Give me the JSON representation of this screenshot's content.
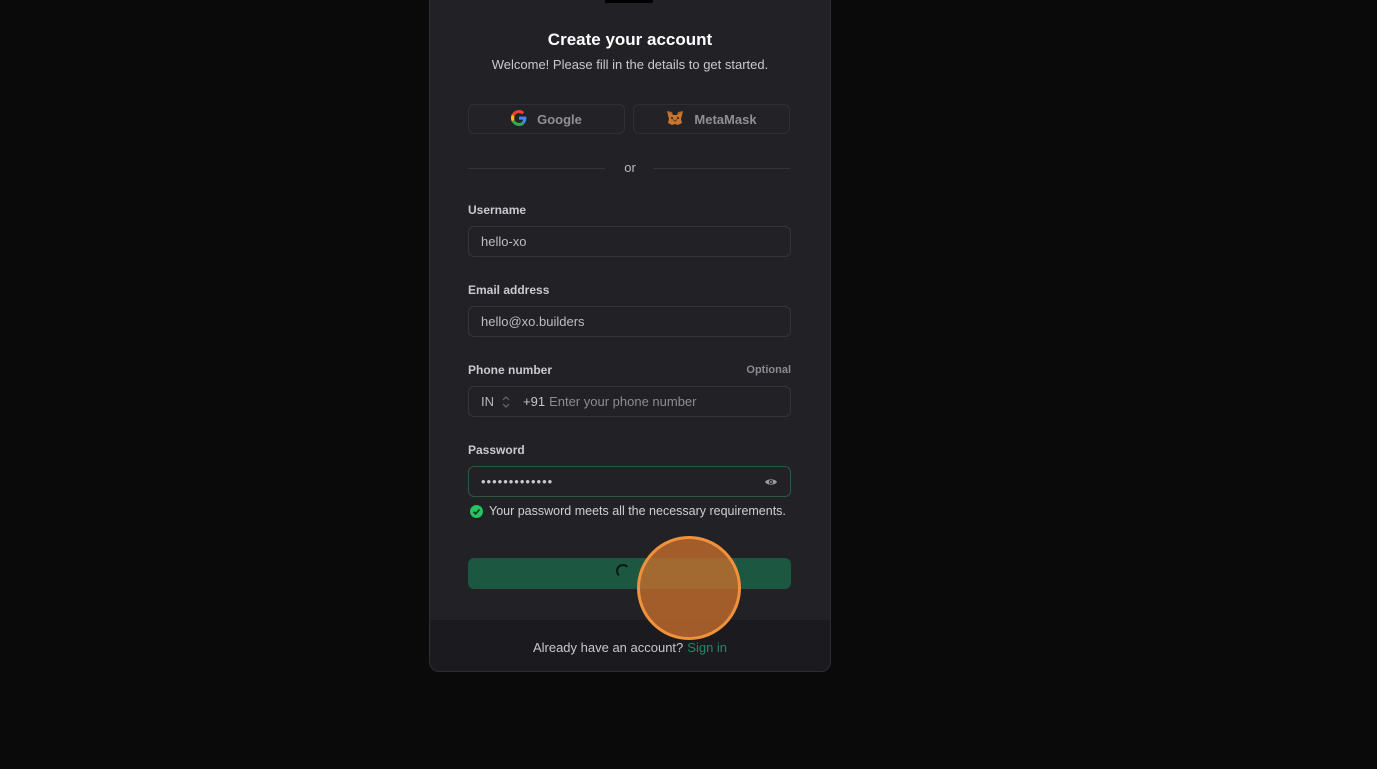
{
  "header": {
    "title": "Create your account",
    "subtitle": "Welcome! Please fill in the details to get started."
  },
  "social": {
    "google_label": "Google",
    "metamask_label": "MetaMask"
  },
  "divider": {
    "text": "or"
  },
  "form": {
    "username": {
      "label": "Username",
      "value": "hello-xo"
    },
    "email": {
      "label": "Email address",
      "value": "hello@xo.builders"
    },
    "phone": {
      "label": "Phone number",
      "optional_label": "Optional",
      "country": "IN",
      "dial_code": "+91",
      "placeholder": "Enter your phone number"
    },
    "password": {
      "label": "Password",
      "masked_value": "•••••••••••••",
      "hint": "Your password meets all the necessary requirements."
    }
  },
  "footer": {
    "prompt": "Already have an account?",
    "link": "Sign in"
  },
  "colors": {
    "accent": "#1b5741",
    "link": "#1f8a63",
    "success": "#22c55e",
    "click_indicator": "#f0913c"
  }
}
